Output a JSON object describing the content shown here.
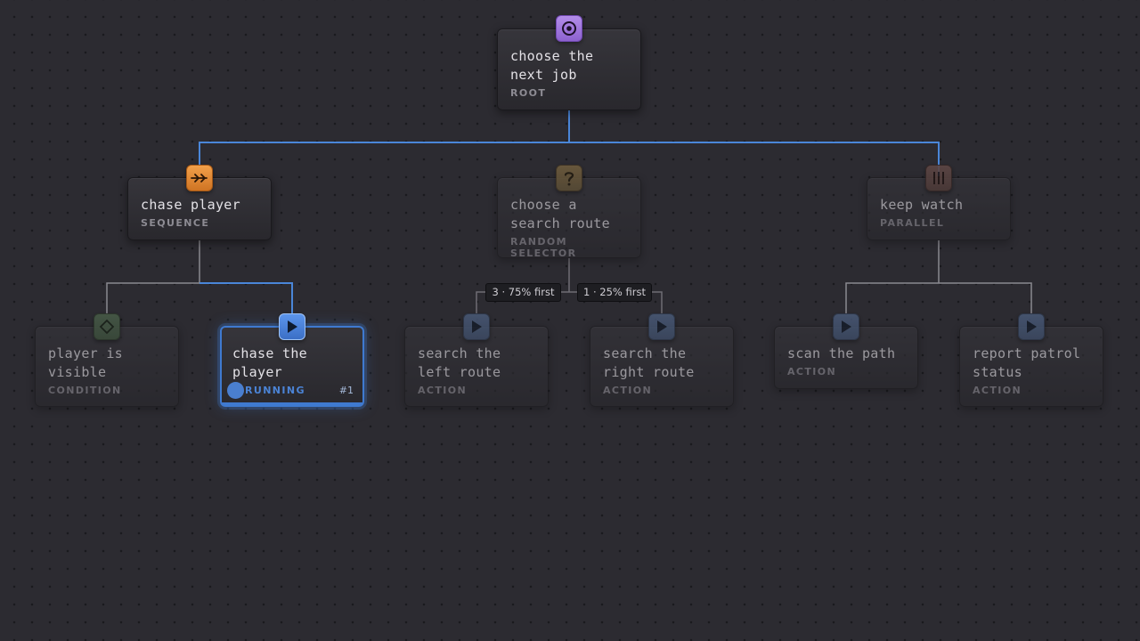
{
  "nodes": {
    "root": {
      "title_1": "choose the",
      "title_2": "next job",
      "kind": "ROOT"
    },
    "chase_player": {
      "title_1": "chase player",
      "kind": "SEQUENCE"
    },
    "choose_route": {
      "title_1": "choose a",
      "title_2": "search route",
      "kind": "RANDOM SELECTOR"
    },
    "keep_watch": {
      "title_1": "keep watch",
      "kind": "PARALLEL"
    },
    "player_visible": {
      "title_1": "player is",
      "title_2": "visible",
      "kind": "CONDITION"
    },
    "chase_the_player": {
      "title_1": "chase the",
      "title_2": "player",
      "status": "RUNNING",
      "run_count": "#1"
    },
    "search_left": {
      "title_1": "search the",
      "title_2": "left route",
      "kind": "ACTION"
    },
    "search_right": {
      "title_1": "search the",
      "title_2": "right route",
      "kind": "ACTION"
    },
    "scan_path": {
      "title_1": "scan the path",
      "kind": "ACTION"
    },
    "report_status": {
      "title_1": "report patrol",
      "title_2": "status",
      "kind": "ACTION"
    }
  },
  "weights": {
    "left": "3 · 75% first",
    "right": "1 · 25% first"
  },
  "colors": {
    "active_edge": "#4a86d8",
    "inactive_edge": "#8a8990",
    "running": "#3f7ad0",
    "root_badge": "#9c72dc",
    "sequence_badge": "#e48a35"
  },
  "icons": {
    "root": "target-icon",
    "sequence": "double-arrow-icon",
    "random_selector": "question-icon",
    "parallel": "parallel-bars-icon",
    "condition": "diamond-icon",
    "action": "play-icon"
  }
}
